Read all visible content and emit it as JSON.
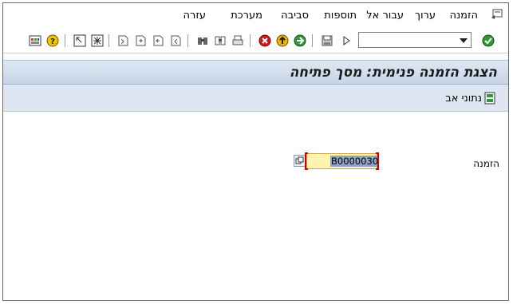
{
  "menu": {
    "items": [
      {
        "key": "order",
        "label": "הזמנה",
        "underline": "ה"
      },
      {
        "key": "edit",
        "label": "ערוך",
        "underline": "ע"
      },
      {
        "key": "goto",
        "label": "עבור אל",
        "underline": "ע"
      },
      {
        "key": "extras",
        "label": "תוספות",
        "underline": "ת"
      },
      {
        "key": "environment",
        "label": "סביבה",
        "underline": "ס"
      },
      {
        "key": "system",
        "label": "מערכת",
        "underline": "מ"
      },
      {
        "key": "help",
        "label": "עזרה",
        "underline": "ע"
      }
    ]
  },
  "toolbar": {
    "command_field_value": ""
  },
  "screen": {
    "title": "הצגת הזמנה פנימית: מסך פתיחה"
  },
  "app_toolbar": {
    "master_data_label": "נתוני אב"
  },
  "form": {
    "order_label": "הזמנה",
    "order_value": "B0000030"
  },
  "colors": {
    "title_bar": "#c7d5e7",
    "app_toolbar": "#dde6f1",
    "input_bg": "#fff3b0",
    "selection": "#8da3c4"
  }
}
